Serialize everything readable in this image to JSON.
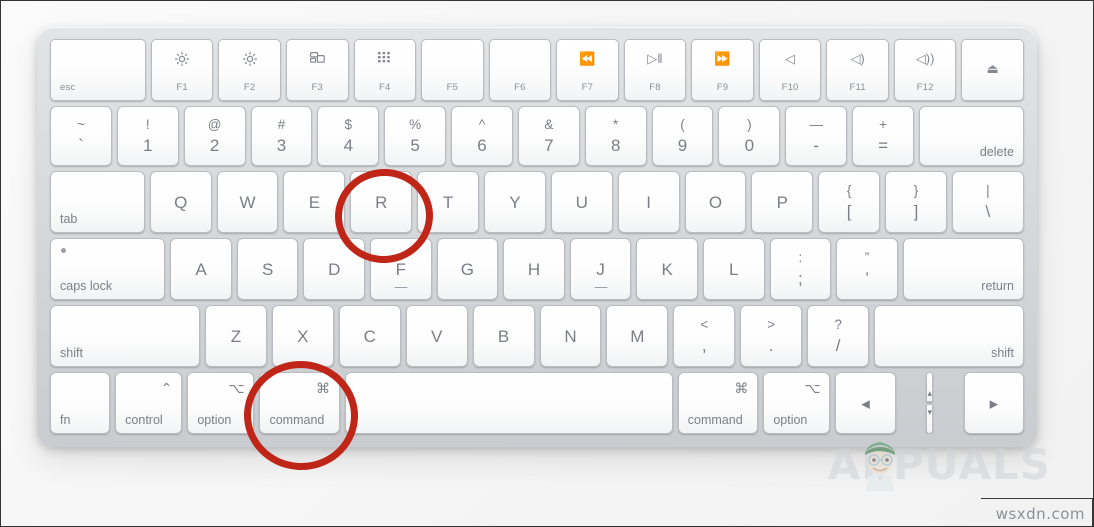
{
  "image": {
    "subject": "Apple Magic Keyboard with annotated keys",
    "watermark_text": "APPUALS",
    "site_credit": "wsxdn.com"
  },
  "colors": {
    "annotation_red": "#bf2617",
    "keyboard_body": "#d6d8da",
    "key_face": "#ffffff",
    "key_text": "#7b7f85",
    "watermark_gray": "#cfd2d6"
  },
  "annotations": [
    {
      "id": "circle-r",
      "target_key": "R",
      "shape": "ellipse",
      "color": "#bf2617"
    },
    {
      "id": "circle-cmd",
      "target_key": "command",
      "shape": "ellipse",
      "color": "#bf2617"
    }
  ],
  "keyboard": {
    "rows": {
      "function_row": [
        {
          "label": "esc",
          "glyph": "",
          "flabel": "",
          "flex": 1.55,
          "style": "esc"
        },
        {
          "label": "F1",
          "glyph": "☼",
          "flabel": "F1",
          "flex": 1
        },
        {
          "label": "F2",
          "glyph": "☼",
          "flabel": "F2",
          "flex": 1
        },
        {
          "label": "F3",
          "glyph": "mission-control",
          "flabel": "F3",
          "flex": 1
        },
        {
          "label": "F4",
          "glyph": "launchpad",
          "flabel": "F4",
          "flex": 1
        },
        {
          "label": "F5",
          "glyph": "",
          "flabel": "F5",
          "flex": 1
        },
        {
          "label": "F6",
          "glyph": "",
          "flabel": "F6",
          "flex": 1
        },
        {
          "label": "F7",
          "glyph": "⏪",
          "flabel": "F7",
          "flex": 1
        },
        {
          "label": "F8",
          "glyph": "▷‖",
          "flabel": "F8",
          "flex": 1
        },
        {
          "label": "F9",
          "glyph": "⏩",
          "flabel": "F9",
          "flex": 1
        },
        {
          "label": "F10",
          "glyph": "◁",
          "flabel": "F10",
          "flex": 1
        },
        {
          "label": "F11",
          "glyph": "◁)",
          "flabel": "F11",
          "flex": 1
        },
        {
          "label": "F12",
          "glyph": "◁))",
          "flabel": "F12",
          "flex": 1
        },
        {
          "label": "eject",
          "glyph": "⏏",
          "flabel": "",
          "flex": 1,
          "style": "eject"
        }
      ],
      "number_row": [
        {
          "top": "~",
          "bot": "`",
          "flex": 1
        },
        {
          "top": "!",
          "bot": "1",
          "flex": 1
        },
        {
          "top": "@",
          "bot": "2",
          "flex": 1
        },
        {
          "top": "#",
          "bot": "3",
          "flex": 1
        },
        {
          "top": "$",
          "bot": "4",
          "flex": 1
        },
        {
          "top": "%",
          "bot": "5",
          "flex": 1
        },
        {
          "top": "^",
          "bot": "6",
          "flex": 1
        },
        {
          "top": "&",
          "bot": "7",
          "flex": 1
        },
        {
          "top": "*",
          "bot": "8",
          "flex": 1
        },
        {
          "top": "(",
          "bot": "9",
          "flex": 1
        },
        {
          "top": ")",
          "bot": "0",
          "flex": 1
        },
        {
          "top": "—",
          "bot": "-",
          "flex": 1
        },
        {
          "top": "+",
          "bot": "=",
          "flex": 1
        },
        {
          "label": "delete",
          "align": "br",
          "flex": 1.72
        }
      ],
      "q_row": [
        {
          "label": "tab",
          "align": "bl",
          "flex": 1.55
        },
        {
          "label": "Q",
          "flex": 1
        },
        {
          "label": "W",
          "flex": 1
        },
        {
          "label": "E",
          "flex": 1
        },
        {
          "label": "R",
          "flex": 1
        },
        {
          "label": "T",
          "flex": 1
        },
        {
          "label": "Y",
          "flex": 1
        },
        {
          "label": "U",
          "flex": 1
        },
        {
          "label": "I",
          "flex": 1
        },
        {
          "label": "O",
          "flex": 1
        },
        {
          "label": "P",
          "flex": 1
        },
        {
          "top": "{",
          "bot": "[",
          "flex": 1
        },
        {
          "top": "}",
          "bot": "]",
          "flex": 1
        },
        {
          "top": "|",
          "bot": "\\",
          "flex": 1.17
        }
      ],
      "a_row": [
        {
          "label": "caps lock",
          "align": "bl",
          "flex": 1.9,
          "caps": true
        },
        {
          "label": "A",
          "flex": 1
        },
        {
          "label": "S",
          "flex": 1
        },
        {
          "label": "D",
          "flex": 1
        },
        {
          "label": "F",
          "flex": 1,
          "homebump": true
        },
        {
          "label": "G",
          "flex": 1
        },
        {
          "label": "H",
          "flex": 1
        },
        {
          "label": "J",
          "flex": 1,
          "homebump": true
        },
        {
          "label": "K",
          "flex": 1
        },
        {
          "label": "L",
          "flex": 1
        },
        {
          "top": ":",
          "bot": ";",
          "flex": 1
        },
        {
          "top": "”",
          "bot": "’",
          "flex": 1
        },
        {
          "label": "return",
          "align": "br",
          "flex": 2.0
        }
      ],
      "z_row": [
        {
          "label": "shift",
          "align": "bl",
          "flex": 2.47
        },
        {
          "label": "Z",
          "flex": 1
        },
        {
          "label": "X",
          "flex": 1
        },
        {
          "label": "C",
          "flex": 1
        },
        {
          "label": "V",
          "flex": 1
        },
        {
          "label": "B",
          "flex": 1
        },
        {
          "label": "N",
          "flex": 1
        },
        {
          "label": "M",
          "flex": 1
        },
        {
          "top": "<",
          "bot": ",",
          "flex": 1
        },
        {
          "top": ">",
          "bot": ".",
          "flex": 1
        },
        {
          "top": "?",
          "bot": "/",
          "flex": 1
        },
        {
          "label": "shift",
          "align": "br",
          "flex": 2.47
        }
      ],
      "space_row": [
        {
          "label": "fn",
          "align": "bl",
          "flex": 1
        },
        {
          "label": "control",
          "glyph": "⌃",
          "align": "bl",
          "flex": 1.12,
          "mod": true
        },
        {
          "label": "option",
          "glyph": "⌥",
          "align": "bl",
          "flex": 1.12,
          "mod": true
        },
        {
          "label": "command",
          "glyph": "⌘",
          "align": "bl",
          "flex": 1.35,
          "mod": true
        },
        {
          "label": "space",
          "flex": 5.6,
          "blank": true
        },
        {
          "label": "command",
          "glyph": "⌘",
          "align": "bl",
          "flex": 1.35,
          "mod": true
        },
        {
          "label": "option",
          "glyph": "⌥",
          "align": "bl",
          "flex": 1.12,
          "mod": true
        },
        {
          "label": "◂",
          "flex": 1,
          "arrow": "left"
        },
        {
          "label": "updown",
          "flex": 1,
          "arrow": "updown",
          "up": "▴",
          "down": "▾"
        },
        {
          "label": "▸",
          "flex": 1,
          "arrow": "right"
        }
      ]
    }
  }
}
